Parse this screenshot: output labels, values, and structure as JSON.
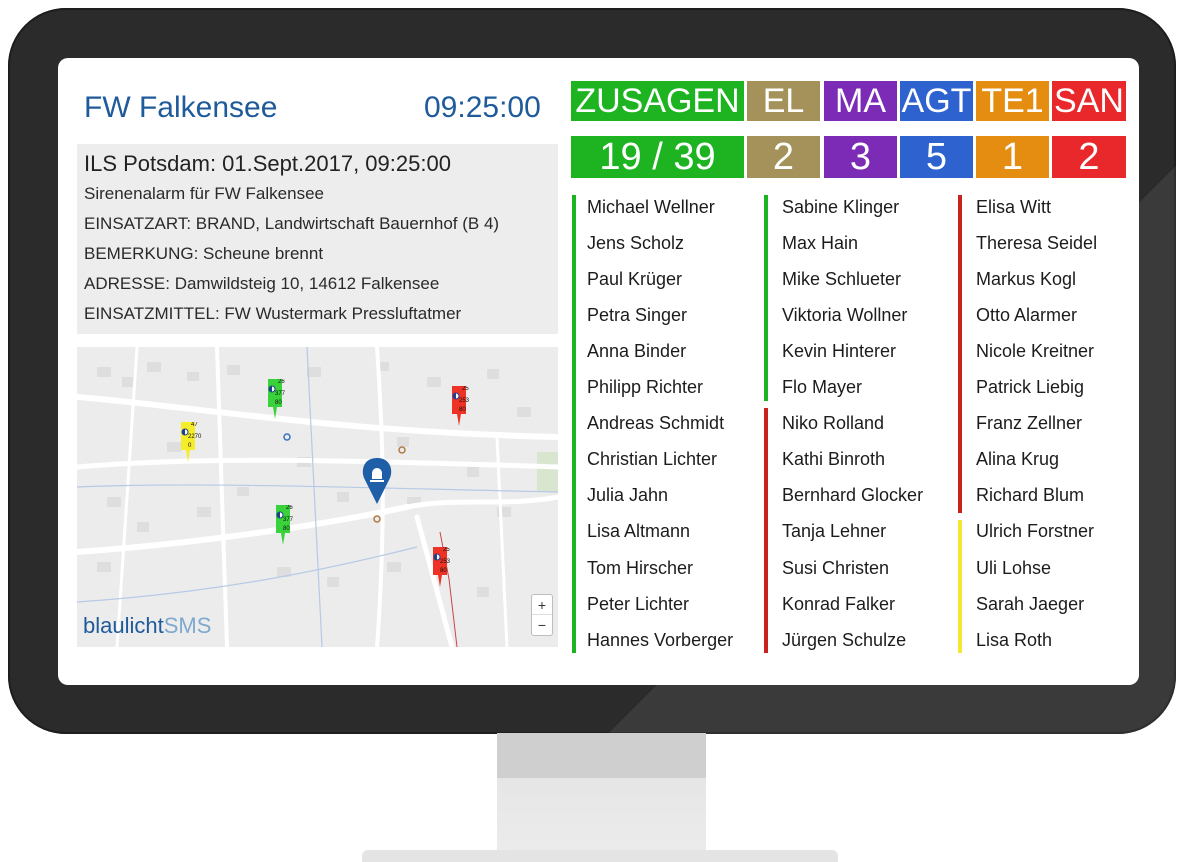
{
  "header": {
    "station": "FW Falkensee",
    "time": "09:25:00"
  },
  "alarm": {
    "headline": "ILS Potsdam: 01.Sept.2017, 09:25:00",
    "lines": [
      "Sirenenalarm für FW Falkensee",
      "EINSATZART: BRAND, Landwirtschaft Bauernhof (B 4)",
      "BEMERKUNG: Scheune brennt",
      "ADRESSE: Damwildsteig 10, 14612 Falkensee",
      "EINSATZMITTEL: FW Wustermark Pressluftatmer"
    ]
  },
  "map": {
    "brand_part1": "blaulicht",
    "brand_part2": "SMS",
    "zoom_in": "+",
    "zoom_out": "−",
    "markers": [
      {
        "color": "#f5ec2a",
        "top": "47",
        "mid": "2270",
        "bot": "0"
      },
      {
        "color": "#39d23a",
        "top": "26",
        "mid": "377",
        "bot": "80"
      },
      {
        "color": "#39d23a",
        "top": "26",
        "mid": "377",
        "bot": "80"
      },
      {
        "color": "#ef3226",
        "top": "25",
        "mid": "253",
        "bot": "80"
      },
      {
        "color": "#ef3226",
        "top": "25",
        "mid": "253",
        "bot": "80"
      }
    ]
  },
  "tiles": [
    {
      "label": "ZUSAGEN",
      "value": "19 / 39",
      "color": "#1db321"
    },
    {
      "label": "EL",
      "value": "2",
      "color": "#a4925a"
    },
    {
      "label": "MA",
      "value": "3",
      "color": "#7b2bb5"
    },
    {
      "label": "AGT",
      "value": "5",
      "color": "#2d62cf"
    },
    {
      "label": "TE1",
      "value": "1",
      "color": "#e48d10"
    },
    {
      "label": "SAN",
      "value": "2",
      "color": "#e8282b"
    }
  ],
  "status_colors": {
    "green": "#1db321",
    "red": "#c9231f",
    "yellow": "#f5e62e"
  },
  "columns": [
    [
      "Michael Wellner",
      "Jens Scholz",
      "Paul Krüger",
      "Petra Singer",
      "Anna Binder",
      "Philipp Richter",
      "Andreas Schmidt",
      "Christian Lichter",
      "Julia Jahn",
      "Lisa Altmann",
      "Tom Hirscher",
      "Peter Lichter",
      "Hannes Vorberger"
    ],
    [
      "Sabine Klinger",
      "Max Hain",
      "Mike Schlueter",
      "Viktoria Wollner",
      "Kevin Hinterer",
      "Flo Mayer",
      "Niko Rolland",
      "Kathi Binroth",
      "Bernhard Glocker",
      "Tanja Lehner",
      "Susi Christen",
      "Konrad Falker",
      "Jürgen Schulze"
    ],
    [
      "Elisa Witt",
      "Theresa Seidel",
      "Markus Kogl",
      "Otto Alarmer",
      "Nicole Kreitner",
      "Patrick Liebig",
      "Franz Zellner",
      "Alina Krug",
      "Richard Blum",
      "Ulrich Forstner",
      "Uli Lohse",
      "Sarah Jaeger",
      "Lisa Roth"
    ]
  ]
}
